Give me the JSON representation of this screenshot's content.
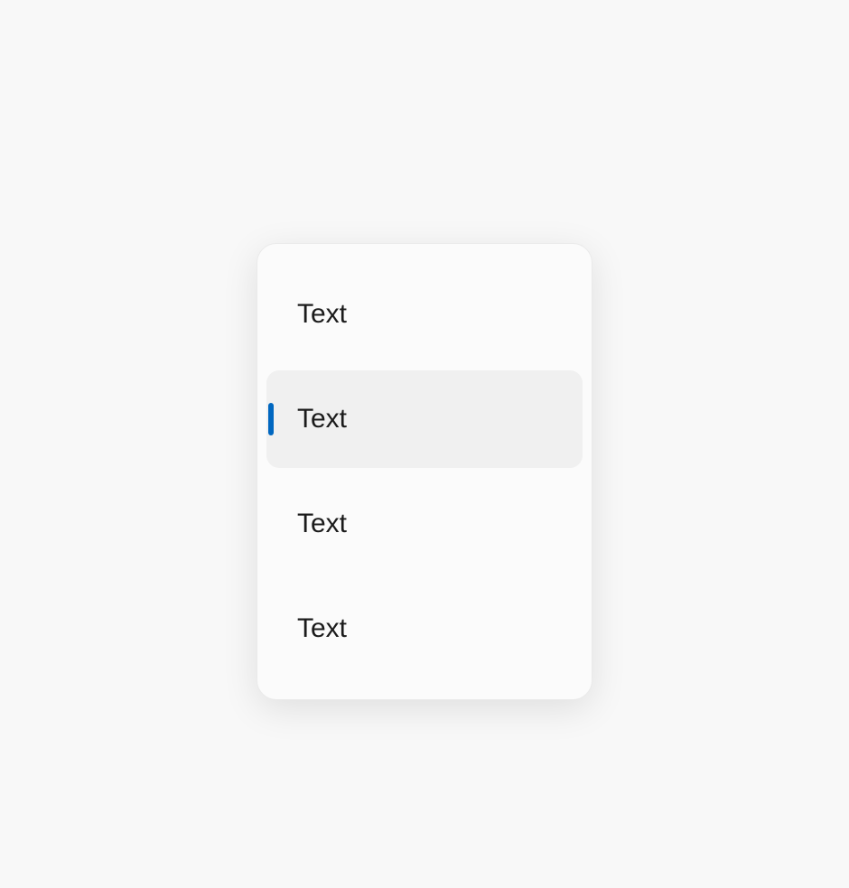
{
  "menu": {
    "accent_color": "#0067c0",
    "selected_index": 1,
    "items": [
      {
        "label": "Text"
      },
      {
        "label": "Text"
      },
      {
        "label": "Text"
      },
      {
        "label": "Text"
      }
    ]
  }
}
